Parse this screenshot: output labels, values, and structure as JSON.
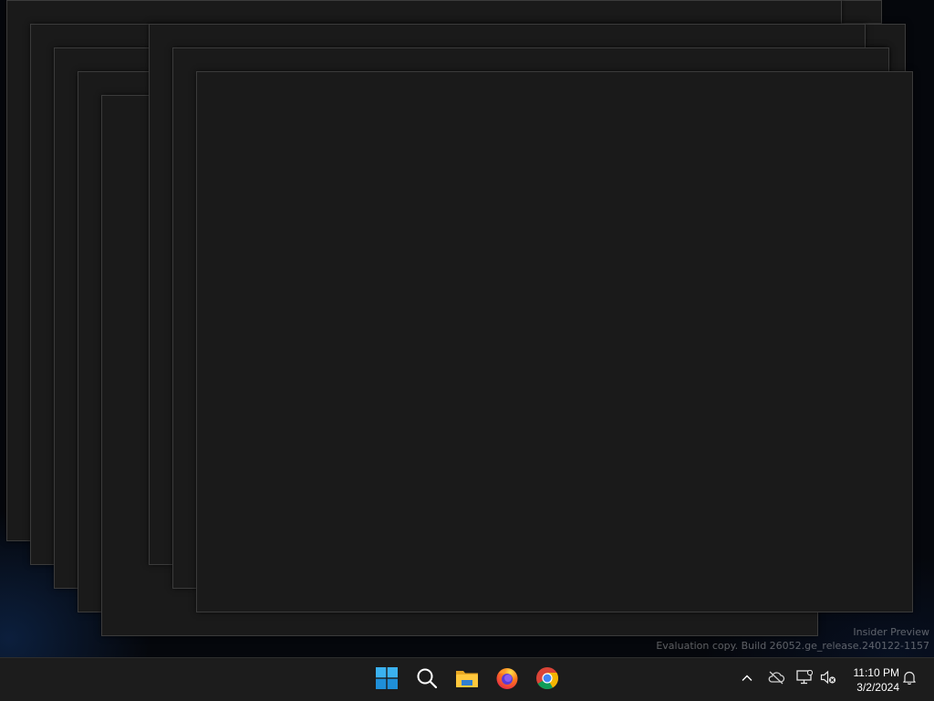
{
  "desktop": {
    "watermark": {
      "line1": "Insider Preview",
      "line2": "Evaluation copy. Build 26052.ge_release.240122-1157"
    },
    "windows": [
      {
        "title": ""
      },
      {
        "title": ""
      },
      {
        "title": ""
      },
      {
        "title": ""
      },
      {
        "title": ""
      },
      {
        "title": ""
      },
      {
        "title": ""
      },
      {
        "title": ""
      },
      {
        "title": ""
      },
      {
        "title": ""
      }
    ]
  },
  "taskbar": {
    "apps": [
      {
        "name": "Start",
        "icon": "windows-logo-icon"
      },
      {
        "name": "Search",
        "icon": "search-icon"
      },
      {
        "name": "File Explorer",
        "icon": "folder-icon"
      },
      {
        "name": "Firefox",
        "icon": "firefox-icon"
      },
      {
        "name": "Google Chrome",
        "icon": "chrome-icon"
      }
    ],
    "tray": {
      "icons": [
        "chevron-up-icon",
        "onedrive-offline-icon",
        "network-icon",
        "volume-muted-icon",
        "notification-bell-icon"
      ],
      "time": "11:10 PM",
      "date": "3/2/2024"
    }
  },
  "colors": {
    "window_bg": "#1a1a1a",
    "window_border": "#3b3b3b",
    "taskbar_bg": "#1c1c1c",
    "windows_blue": "#3bb2f0"
  }
}
